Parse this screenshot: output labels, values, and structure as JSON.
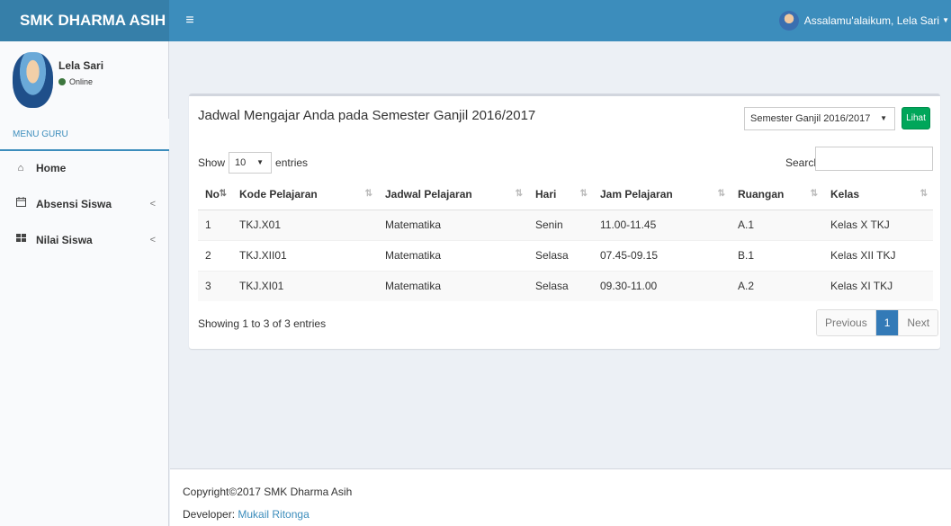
{
  "header": {
    "brand": "SMK DHARMA ASIH",
    "toggle_icon": "≡",
    "user_greeting": "Assalamu'alaikum, Lela Sari"
  },
  "sidebar": {
    "user_name": "Lela Sari",
    "user_status": "Online",
    "menu_header": "MENU GURU",
    "items": [
      {
        "icon": "home-icon",
        "label": "Home",
        "has_submenu": false
      },
      {
        "icon": "calendar-icon",
        "label": "Absensi Siswa",
        "has_submenu": true
      },
      {
        "icon": "th-icon",
        "label": "Nilai Siswa",
        "has_submenu": true
      }
    ]
  },
  "main": {
    "title": "Jadwal Mengajar Anda pada Semester Ganjil 2016/2017",
    "semester_select": "Semester Ganjil 2016/2017",
    "lihat_button": "Lihat",
    "show_label": "Show",
    "entries_value": "10",
    "entries_label": "entries",
    "search_label": "Search:",
    "search_value": "",
    "columns": [
      "No",
      "Kode Pelajaran",
      "Jadwal Pelajaran",
      "Hari",
      "Jam Pelajaran",
      "Ruangan",
      "Kelas"
    ],
    "rows": [
      [
        "1",
        "TKJ.X01",
        "Matematika",
        "Senin",
        "11.00-11.45",
        "A.1",
        "Kelas X TKJ"
      ],
      [
        "2",
        "TKJ.XII01",
        "Matematika",
        "Selasa",
        "07.45-09.15",
        "B.1",
        "Kelas XII TKJ"
      ],
      [
        "3",
        "TKJ.XI01",
        "Matematika",
        "Selasa",
        "09.30-11.00",
        "A.2",
        "Kelas XI TKJ"
      ]
    ],
    "info": "Showing 1 to 3 of 3 entries",
    "pagination": {
      "previous": "Previous",
      "current": "1",
      "next": "Next"
    }
  },
  "footer": {
    "copyright": "Copyright©2017 SMK Dharma Asih",
    "developer_label": "Developer:",
    "developer_name": "Mukail Ritonga"
  },
  "colors": {
    "header": "#3c8dbc",
    "logo_bg": "#367fa9",
    "button_green": "#00a65a",
    "page_active": "#337ab7",
    "sidebar_bg": "#f9fafc",
    "content_bg": "#ecf0f5"
  }
}
